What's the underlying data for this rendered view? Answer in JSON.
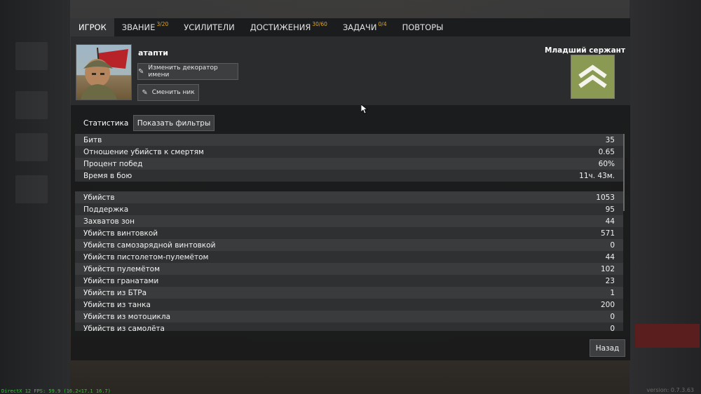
{
  "tabs": [
    {
      "label": "ИГРОК",
      "badge": "",
      "active": true
    },
    {
      "label": "ЗВАНИЕ",
      "badge": "3/20",
      "active": false
    },
    {
      "label": "УСИЛИТЕЛИ",
      "badge": "",
      "active": false
    },
    {
      "label": "ДОСТИЖЕНИЯ",
      "badge": "30/60",
      "active": false
    },
    {
      "label": "ЗАДАЧИ",
      "badge": "0/4",
      "active": false
    },
    {
      "label": "ПОВТОРЫ",
      "badge": "",
      "active": false
    }
  ],
  "player": {
    "name": "атапти",
    "change_decorator_label": "Изменить декоратор имени",
    "change_nick_label": "Сменить ник"
  },
  "rank": {
    "title": "Младший сержант",
    "badge_color": "#8a9a52"
  },
  "stats": {
    "label": "Статистика",
    "filter_button": "Показать фильтры",
    "group1": [
      {
        "name": "Битв",
        "value": "35"
      },
      {
        "name": "Отношение убийств к смертям",
        "value": "0.65"
      },
      {
        "name": "Процент побед",
        "value": "60%"
      },
      {
        "name": "Время в бою",
        "value": "11ч. 43м."
      }
    ],
    "group2": [
      {
        "name": "Убийств",
        "value": "1053"
      },
      {
        "name": "Поддержка",
        "value": "95"
      },
      {
        "name": "Захватов зон",
        "value": "44"
      },
      {
        "name": "Убийств винтовкой",
        "value": "571"
      },
      {
        "name": "Убийств самозарядной винтовкой",
        "value": "0"
      },
      {
        "name": "Убийств пистолетом-пулемётом",
        "value": "44"
      },
      {
        "name": "Убийств пулемётом",
        "value": "102"
      },
      {
        "name": "Убийств гранатами",
        "value": "23"
      },
      {
        "name": "Убийств из БТРа",
        "value": "1"
      },
      {
        "name": "Убийств из танка",
        "value": "200"
      },
      {
        "name": "Убийств из мотоцикла",
        "value": "0"
      },
      {
        "name": "Убийств из самолёта",
        "value": "0"
      }
    ]
  },
  "back_button": "Назад",
  "footer": {
    "fps": "DirectX 12 FPS: 59.9 (16.2<17.1 16.7)",
    "version": "version: 0.7.3.63"
  }
}
